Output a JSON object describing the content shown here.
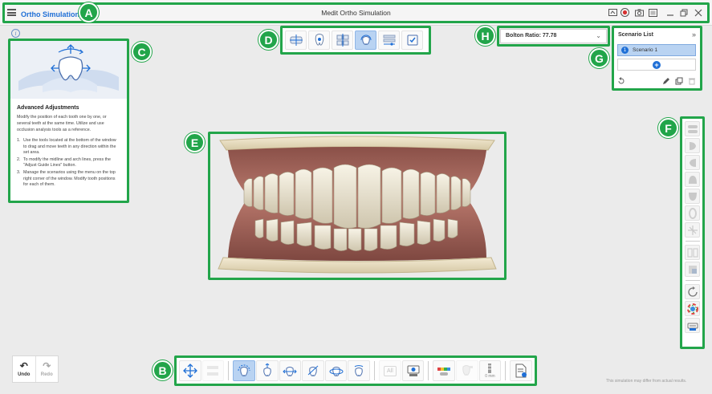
{
  "titlebar": {
    "app_title": "Ortho Simulation",
    "app_badge": "ⓘ",
    "window_title": "Medit Ortho Simulation"
  },
  "callouts": {
    "a": "A",
    "b": "B",
    "c": "C",
    "d": "D",
    "e": "E",
    "f": "F",
    "g": "G",
    "h": "H"
  },
  "help": {
    "title": "Advanced Adjustments",
    "description": "Modify the position of each tooth one by one, or several teeth at the same time. Utilize and use occlusion analysis tools as a reference.",
    "steps": [
      {
        "num": "1.",
        "text": "Use the tools located at the bottom of the window to drag and move teeth in any direction within the set area."
      },
      {
        "num": "2.",
        "text": "To modify the midline and arch lines, press the \"Adjust Guide Lines\" button."
      },
      {
        "num": "3.",
        "text": "Manage the scenarios using the menu on the top right corner of the window. Modify tooth positions for each of them."
      }
    ]
  },
  "bolton": {
    "label": "Bolton Ratio: 77.78"
  },
  "scenario": {
    "title": "Scenario List",
    "items": [
      {
        "index": "1",
        "label": "Scenario 1"
      }
    ],
    "add_label": "+"
  },
  "bottom_toolbar": {
    "all_label": "All",
    "range_label": "0 mm"
  },
  "undo": {
    "label": "Undo"
  },
  "redo": {
    "label": "Redo"
  },
  "disclaimer": "This simulation may differ from actual results.",
  "colors": {
    "accent_green": "#22a54a",
    "brand_blue": "#1f6fd6",
    "active_tool": "#b9d3f2"
  }
}
